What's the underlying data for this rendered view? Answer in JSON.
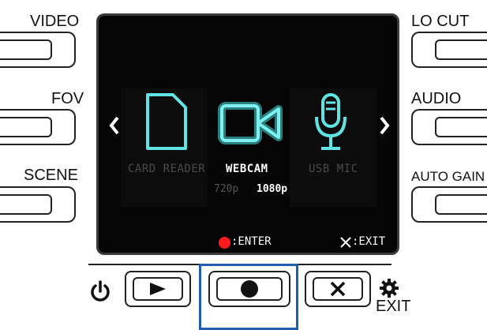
{
  "left_buttons": [
    {
      "label": "VIDEO"
    },
    {
      "label": "FOV"
    },
    {
      "label": "SCENE"
    }
  ],
  "right_buttons": [
    {
      "label": "LO CUT"
    },
    {
      "label": "AUDIO"
    },
    {
      "label": "AUTO GAIN"
    }
  ],
  "screen": {
    "modes": [
      {
        "label": "CARD READER",
        "icon": "sd-card-icon",
        "active": false
      },
      {
        "label": "WEBCAM",
        "icon": "video-camera-icon",
        "active": true
      },
      {
        "label": "USB MIC",
        "icon": "microphone-icon",
        "active": false
      }
    ],
    "resolutions": [
      {
        "label": "720p",
        "selected": false
      },
      {
        "label": "1080p",
        "selected": true
      }
    ],
    "footer": {
      "enter_label": ":ENTER",
      "exit_label": ":EXIT"
    }
  },
  "bottom": {
    "exit_label": "EXIT"
  },
  "colors": {
    "accent_cyan": "#5fe3e3",
    "record_red": "#ff1a1a",
    "highlight_blue": "#1f5fad",
    "screen_bg": "#050505"
  }
}
